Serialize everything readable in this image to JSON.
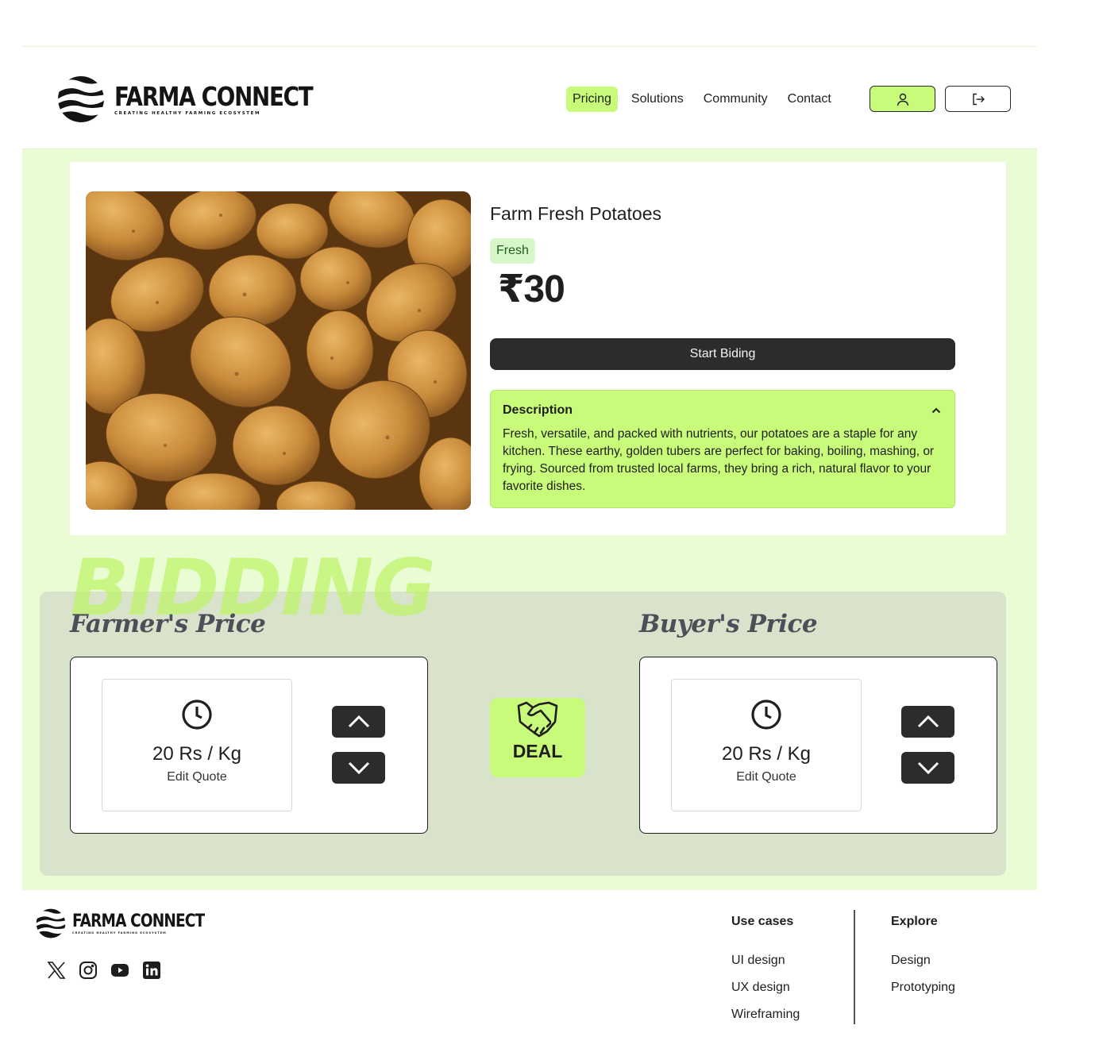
{
  "brand": {
    "name": "FARMA CONNECT",
    "tagline": "CREATING HEALTHY FARMING ECOSYSTEM"
  },
  "nav": {
    "items": [
      "Pricing",
      "Solutions",
      "Community",
      "Contact"
    ],
    "active": "Pricing"
  },
  "header_icons": {
    "user": "user-icon",
    "logout": "logout-icon"
  },
  "product": {
    "title": "Farm Fresh Potatoes",
    "badge": "Fresh",
    "price": "₹30",
    "bid_button": "Start Biding",
    "description": {
      "heading": "Description",
      "body": "Fresh, versatile, and packed with nutrients, our potatoes are a staple for any kitchen. These earthy, golden tubers are perfect for baking, boiling, mashing, or frying. Sourced from trusted local farms, they bring a rich, natural flavor to your favorite dishes."
    }
  },
  "bidding": {
    "banner": "BIDDING",
    "farmer": {
      "title": "Farmer's Price",
      "value": "20 Rs / Kg",
      "edit": "Edit Quote"
    },
    "buyer": {
      "title": "Buyer's Price",
      "value": "20 Rs / Kg",
      "edit": "Edit Quote"
    },
    "deal": "DEAL"
  },
  "footer": {
    "socials": [
      "x-icon",
      "instagram-icon",
      "youtube-icon",
      "linkedin-icon"
    ],
    "use_cases": {
      "title": "Use cases",
      "links": [
        "UI design",
        "UX design",
        "Wireframing"
      ]
    },
    "explore": {
      "title": "Explore",
      "links": [
        "Design",
        "Prototyping"
      ]
    }
  },
  "colors": {
    "accent": "#c9fb7a",
    "page_bg": "#eafcd3",
    "panel": "#d9e2cb",
    "dark": "#2c2c2c"
  }
}
